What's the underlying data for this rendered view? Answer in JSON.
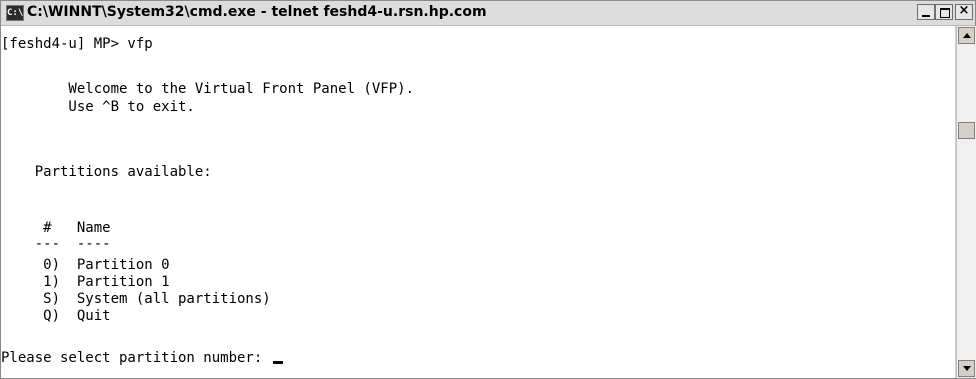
{
  "window": {
    "title": "C:\\WINNT\\System32\\cmd.exe - telnet feshd4-u.rsn.hp.com",
    "app_icon_glyph": "C:\\",
    "icons": {
      "app": "cmd-console-icon",
      "minimize": "minimize-icon",
      "maximize": "maximize-icon",
      "close": "close-icon"
    }
  },
  "console": {
    "lines": [
      "[feshd4-u] MP> vfp",
      "        Welcome to the Virtual Front Panel (VFP).",
      "        Use ^B to exit.",
      "    Partitions available:",
      "     #   Name",
      "    ---  ----",
      "     0)  Partition 0",
      "     1)  Partition 1",
      "     S)  System (all partitions)",
      "     Q)  Quit",
      "Please select partition number: "
    ]
  },
  "scrollbar": {
    "up_icon": "scroll-up-arrow-icon",
    "down_icon": "scroll-down-arrow-icon"
  }
}
